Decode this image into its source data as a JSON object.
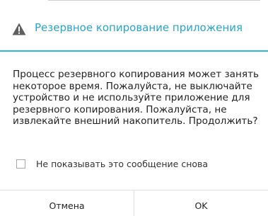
{
  "dialog": {
    "title": "Резервное копирование приложения",
    "title_icon": "warning-icon",
    "accent_color": "#33b5e5",
    "message": "Процесс резервного копирования может занять некоторое время. Пожалуйста, не выключайте устройство и не используйте приложение для резервного копирования. Пожалуйста, не извлекайте внешний накопитель. Продолжить?",
    "checkbox": {
      "label": "Не показывать это сообщение снова",
      "checked": false
    },
    "buttons": {
      "cancel_label": "Отмена",
      "ok_label": "OK"
    }
  }
}
